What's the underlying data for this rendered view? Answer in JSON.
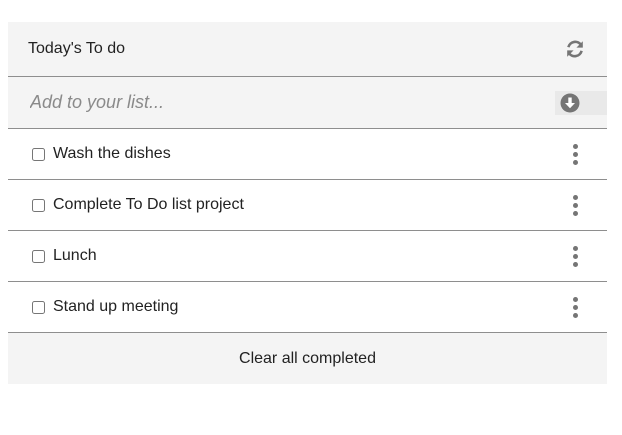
{
  "header": {
    "title": "Today's To do",
    "refresh_icon": "refresh-icon"
  },
  "add": {
    "placeholder": "Add to your list...",
    "value": "",
    "button_icon": "arrow-circle-down-icon"
  },
  "items": [
    {
      "label": "Wash the dishes",
      "checked": false
    },
    {
      "label": "Complete To Do list project",
      "checked": false
    },
    {
      "label": "Lunch",
      "checked": false
    },
    {
      "label": "Stand up meeting",
      "checked": false
    }
  ],
  "footer": {
    "clear_label": "Clear all completed"
  },
  "colors": {
    "panel_background": "#f4f4f4",
    "divider": "#8e8e8e",
    "icon": "#757575",
    "text": "#222222",
    "placeholder": "#8a8a8a"
  }
}
